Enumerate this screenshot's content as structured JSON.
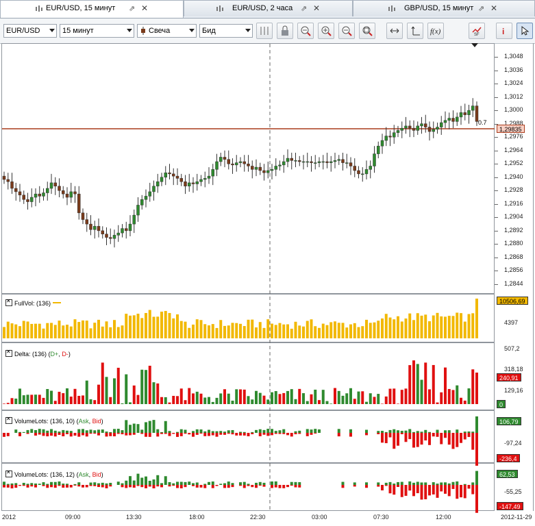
{
  "tabs": [
    {
      "label": "EUR/USD,  15 минут",
      "active": true
    },
    {
      "label": "EUR/USD,  2 часа",
      "active": false
    },
    {
      "label": "GBP/USD,  15 минут",
      "active": false
    }
  ],
  "toolbar": {
    "symbol": "EUR/USD",
    "timeframe": "15 минут",
    "chart_type": "Свеча",
    "price_type": "Бид",
    "buttons": [
      "cursor-lock-icon",
      "lock-icon",
      "zoom-fit-icon",
      "zoom-in-icon",
      "zoom-out-icon",
      "zoom-reset-icon",
      "scroll-left-right-icon",
      "axis-scale-icon",
      "function-icon",
      "indicators-icon",
      "info-icon",
      "pointer-icon"
    ],
    "indicators_label": "SF"
  },
  "price_axis": {
    "ticks": [
      "1,3048",
      "1,3036",
      "1,3024",
      "1,3012",
      "1,3000",
      "1,2988",
      "1,2976",
      "1,2964",
      "1,2952",
      "1,2940",
      "1,2928",
      "1,2916",
      "1,2904",
      "1,2892",
      "1,2880",
      "1,2868",
      "1,2856",
      "1,2844"
    ],
    "current_price": "1,29835",
    "current_line_note": "0.7"
  },
  "panels": [
    {
      "label": "FullVol: (136)",
      "tags": [
        "10506,69"
      ],
      "ticks": [
        "4397"
      ]
    },
    {
      "label": "Delta: (136)",
      "legend": [
        "D+",
        "D-"
      ],
      "tags": [
        "240,91",
        "0"
      ],
      "ticks": [
        "507,2",
        "318,18",
        "129,16"
      ]
    },
    {
      "label": "VolumeLots: (136, 10)",
      "legend": [
        "Ask",
        "Bid"
      ],
      "tags": [
        "106,79",
        "-236,4"
      ],
      "ticks": [
        "-97,24"
      ]
    },
    {
      "label": "VolumeLots: (136, 12)",
      "legend": [
        "Ask",
        "Bid"
      ],
      "tags": [
        "62,53",
        "-147,49"
      ],
      "ticks": [
        "-55,25"
      ]
    }
  ],
  "time_axis": [
    "2012",
    "09:00",
    "13:30",
    "18:00",
    "22:30",
    "03:00",
    "07:30",
    "12:00",
    "2012-11-29"
  ],
  "colors": {
    "up": "#2f8a2f",
    "down": "#e01010",
    "volume": "#f2b800",
    "price_line": "#a83a1a"
  },
  "chart_data": {
    "type": "candlestick",
    "symbol": "EUR/USD",
    "timeframe": "15 минут",
    "ylim": [
      1.2836,
      1.3056
    ],
    "close": [
      1.2938,
      1.2936,
      1.293,
      1.2927,
      1.2924,
      1.292,
      1.2918,
      1.2922,
      1.2925,
      1.2923,
      1.2926,
      1.293,
      1.2935,
      1.2932,
      1.2928,
      1.2925,
      1.2922,
      1.2927,
      1.2925,
      1.2908,
      1.2902,
      1.2898,
      1.2893,
      1.2896,
      1.2892,
      1.2889,
      1.2886,
      1.2885,
      1.2888,
      1.289,
      1.2894,
      1.2892,
      1.2898,
      1.2906,
      1.2915,
      1.292,
      1.2923,
      1.2927,
      1.2932,
      1.2936,
      1.294,
      1.2944,
      1.2943,
      1.2941,
      1.2939,
      1.2936,
      1.2932,
      1.2935,
      1.2934,
      1.2936,
      1.2938,
      1.2939,
      1.2941,
      1.2947,
      1.2954,
      1.2958,
      1.2956,
      1.2952,
      1.2951,
      1.2953,
      1.2954,
      1.2952,
      1.295,
      1.2947,
      1.2949,
      1.2946,
      1.2944,
      1.2946,
      1.2947,
      1.295,
      1.2951,
      1.2954,
      1.2957,
      1.2955,
      1.2955,
      1.2954,
      1.2954,
      1.2954,
      1.2953,
      1.2953,
      1.2954,
      1.2954,
      1.2953,
      1.2954,
      1.2955,
      1.2956,
      1.2953,
      1.2953,
      1.295,
      1.2946,
      1.2943,
      1.2943,
      1.2947,
      1.295,
      1.2961,
      1.2968,
      1.2973,
      1.2977,
      1.2976,
      1.298,
      1.2982,
      1.2984,
      1.2986,
      1.2984,
      1.2982,
      1.2986,
      1.2988,
      1.2985,
      1.2981,
      1.2983,
      1.2985,
      1.2989,
      1.2991,
      1.2993,
      1.299,
      1.2994,
      1.2998,
      1.2996,
      1.3,
      1.3004,
      1.299
    ],
    "indicators": {
      "FullVol": {
        "period": 136,
        "last": 10506.69,
        "mid_tick": 4397
      },
      "Delta": {
        "period": 136,
        "last": 240.91,
        "ticks": [
          507.2,
          318.18,
          129.16,
          0
        ]
      },
      "VolumeLots_10": {
        "params": [
          136,
          10
        ],
        "ask_last": 106.79,
        "bid_last": -236.4,
        "tick": -97.24
      },
      "VolumeLots_12": {
        "params": [
          136,
          12
        ],
        "ask_last": 62.53,
        "bid_last": -147.49,
        "tick": -55.25
      }
    },
    "time_ticks": [
      "2012",
      "09:00",
      "13:30",
      "18:00",
      "22:30",
      "03:00",
      "07:30",
      "12:00",
      "2012-11-29"
    ]
  }
}
